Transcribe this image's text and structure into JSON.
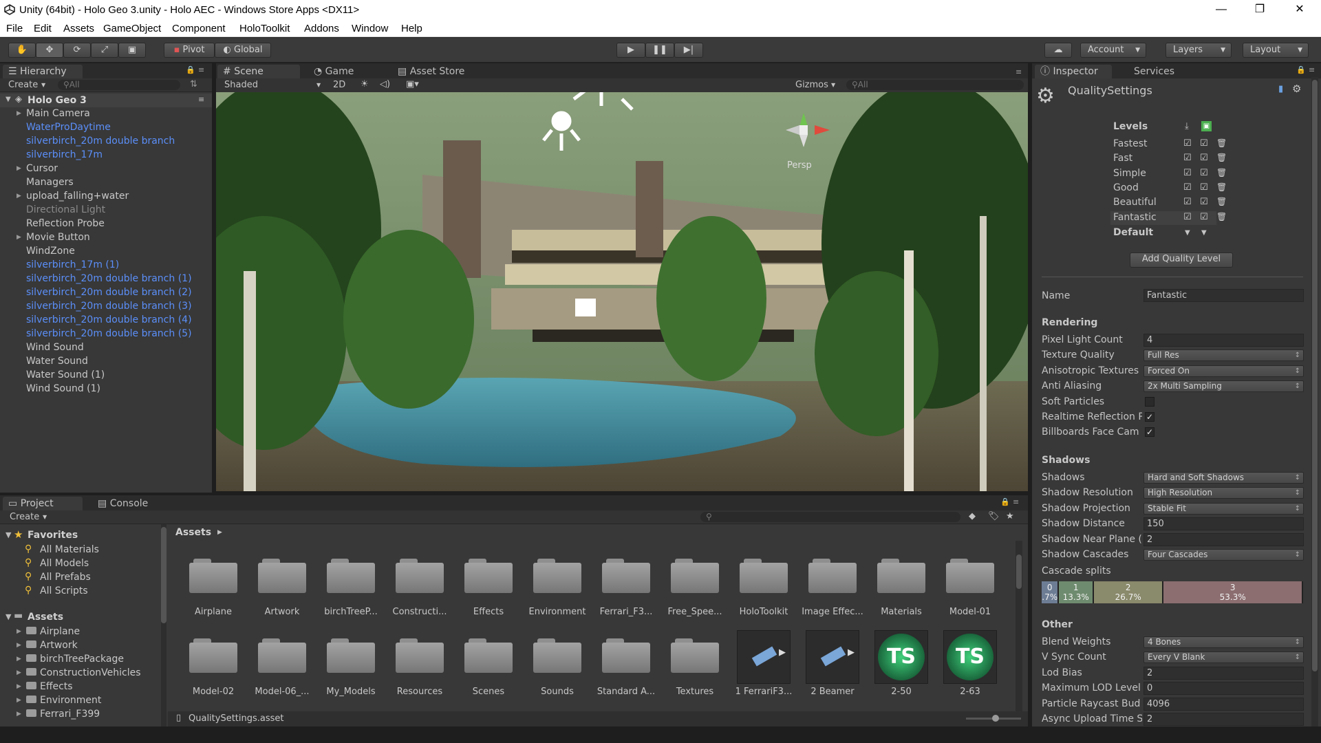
{
  "window": {
    "title": "Unity (64bit) - Holo Geo 3.unity - Holo AEC - Windows Store Apps <DX11>",
    "controls": [
      "—",
      "❐",
      "✕"
    ]
  },
  "menu": [
    "File",
    "Edit",
    "Assets",
    "GameObject",
    "Component",
    "HoloToolkit",
    "Addons",
    "Window",
    "Help"
  ],
  "toolbar": {
    "pivot": "Pivot",
    "global": "Global",
    "account": "Account",
    "layers": "Layers",
    "layout": "Layout"
  },
  "hierarchy": {
    "tab": "Hierarchy",
    "create": "Create",
    "search_placeholder": "All",
    "scene_name": "Holo Geo 3",
    "items": [
      {
        "label": "Main Camera",
        "style": "normal",
        "expand": true
      },
      {
        "label": "WaterProDaytime",
        "style": "blue",
        "expand": false
      },
      {
        "label": "silverbirch_20m double branch",
        "style": "blue",
        "expand": false
      },
      {
        "label": "silverbirch_17m",
        "style": "blue",
        "expand": false
      },
      {
        "label": "Cursor",
        "style": "normal",
        "expand": true
      },
      {
        "label": "Managers",
        "style": "normal",
        "expand": false
      },
      {
        "label": "upload_falling+water",
        "style": "normal",
        "expand": true
      },
      {
        "label": "Directional Light",
        "style": "grey",
        "expand": false
      },
      {
        "label": "Reflection Probe",
        "style": "normal",
        "expand": false
      },
      {
        "label": "Movie Button",
        "style": "normal",
        "expand": true
      },
      {
        "label": "WindZone",
        "style": "normal",
        "expand": false
      },
      {
        "label": "silverbirch_17m (1)",
        "style": "blue",
        "expand": false
      },
      {
        "label": "silverbirch_20m double branch (1)",
        "style": "blue",
        "expand": false
      },
      {
        "label": "silverbirch_20m double branch (2)",
        "style": "blue",
        "expand": false
      },
      {
        "label": "silverbirch_20m double branch (3)",
        "style": "blue",
        "expand": false
      },
      {
        "label": "silverbirch_20m double branch (4)",
        "style": "blue",
        "expand": false
      },
      {
        "label": "silverbirch_20m double branch (5)",
        "style": "blue",
        "expand": false
      },
      {
        "label": "Wind Sound",
        "style": "normal",
        "expand": false
      },
      {
        "label": "Water Sound",
        "style": "normal",
        "expand": false
      },
      {
        "label": "Water Sound (1)",
        "style": "normal",
        "expand": false
      },
      {
        "label": "Wind Sound (1)",
        "style": "normal",
        "expand": false
      }
    ]
  },
  "scene_view": {
    "tabs": [
      "Scene",
      "Game",
      "Asset Store"
    ],
    "shading": "Shaded",
    "mode_2d": "2D",
    "gizmos": "Gizmos",
    "search_placeholder": "All",
    "persp": "Persp"
  },
  "inspector": {
    "tabs": [
      "Inspector",
      "Services"
    ],
    "title": "QualitySettings",
    "levels_header": "Levels",
    "levels": [
      "Fastest",
      "Fast",
      "Simple",
      "Good",
      "Beautiful",
      "Fantastic"
    ],
    "default_label": "Default",
    "add_button": "Add Quality Level",
    "name_label": "Name",
    "name_value": "Fantastic",
    "rendering_header": "Rendering",
    "rendering": [
      {
        "label": "Pixel Light Count",
        "kind": "field",
        "value": "4"
      },
      {
        "label": "Texture Quality",
        "kind": "dropdown",
        "value": "Full Res"
      },
      {
        "label": "Anisotropic Textures",
        "kind": "dropdown",
        "value": "Forced On"
      },
      {
        "label": "Anti Aliasing",
        "kind": "dropdown",
        "value": "2x Multi Sampling"
      },
      {
        "label": "Soft Particles",
        "kind": "check",
        "value": ""
      },
      {
        "label": "Realtime Reflection P",
        "kind": "check",
        "value": "✓"
      },
      {
        "label": "Billboards Face Cam",
        "kind": "check",
        "value": "✓"
      }
    ],
    "shadows_header": "Shadows",
    "shadows": [
      {
        "label": "Shadows",
        "kind": "dropdown",
        "value": "Hard and Soft Shadows"
      },
      {
        "label": "Shadow Resolution",
        "kind": "dropdown",
        "value": "High Resolution"
      },
      {
        "label": "Shadow Projection",
        "kind": "dropdown",
        "value": "Stable Fit"
      },
      {
        "label": "Shadow Distance",
        "kind": "field",
        "value": "150"
      },
      {
        "label": "Shadow Near Plane (",
        "kind": "field",
        "value": "2"
      },
      {
        "label": "Shadow Cascades",
        "kind": "dropdown",
        "value": "Four Cascades"
      }
    ],
    "cascade_label": "Cascade splits",
    "cascades": [
      {
        "index": "0",
        "pct": ".7%",
        "fraction": 0.067,
        "color": "#6d7d94"
      },
      {
        "index": "1",
        "pct": "13.3%",
        "fraction": 0.133,
        "color": "#6f8b6f"
      },
      {
        "index": "2",
        "pct": "26.7%",
        "fraction": 0.267,
        "color": "#8a8a6c"
      },
      {
        "index": "3",
        "pct": "53.3%",
        "fraction": 0.533,
        "color": "#8c6e70"
      }
    ],
    "other_header": "Other",
    "other": [
      {
        "label": "Blend Weights",
        "kind": "dropdown",
        "value": "4 Bones"
      },
      {
        "label": "V Sync Count",
        "kind": "dropdown",
        "value": "Every V Blank"
      },
      {
        "label": "Lod Bias",
        "kind": "field",
        "value": "2"
      },
      {
        "label": "Maximum LOD Level",
        "kind": "field",
        "value": "0"
      },
      {
        "label": "Particle Raycast Bud",
        "kind": "field",
        "value": "4096"
      },
      {
        "label": "Async Upload Time S",
        "kind": "field",
        "value": "2"
      }
    ]
  },
  "project": {
    "tabs": [
      "Project",
      "Console"
    ],
    "create": "Create",
    "favorites_header": "Favorites",
    "favorites": [
      "All Materials",
      "All Models",
      "All Prefabs",
      "All Scripts"
    ],
    "assets_header": "Assets",
    "asset_tree": [
      "Airplane",
      "Artwork",
      "birchTreePackage",
      "ConstructionVehicles",
      "Effects",
      "Environment",
      "Ferrari_F399",
      "Free_SpeedTrees"
    ],
    "breadcrumb": "Assets",
    "row1": [
      "Airplane",
      "Artwork",
      "birchTreeP...",
      "Constructi...",
      "Effects",
      "Environment",
      "Ferrari_F3...",
      "Free_Spee...",
      "HoloToolkit",
      "Image Effec...",
      "Materials",
      "Model-01"
    ],
    "row2_folders": [
      "Model-02",
      "Model-06_...",
      "My_Models",
      "Resources",
      "Scenes",
      "Sounds",
      "Standard A...",
      "Textures"
    ],
    "row2_assets": [
      "1 FerrariF3...",
      "2 Beamer",
      "2-50",
      "2-63"
    ],
    "selected_file": "QualitySettings.asset"
  }
}
